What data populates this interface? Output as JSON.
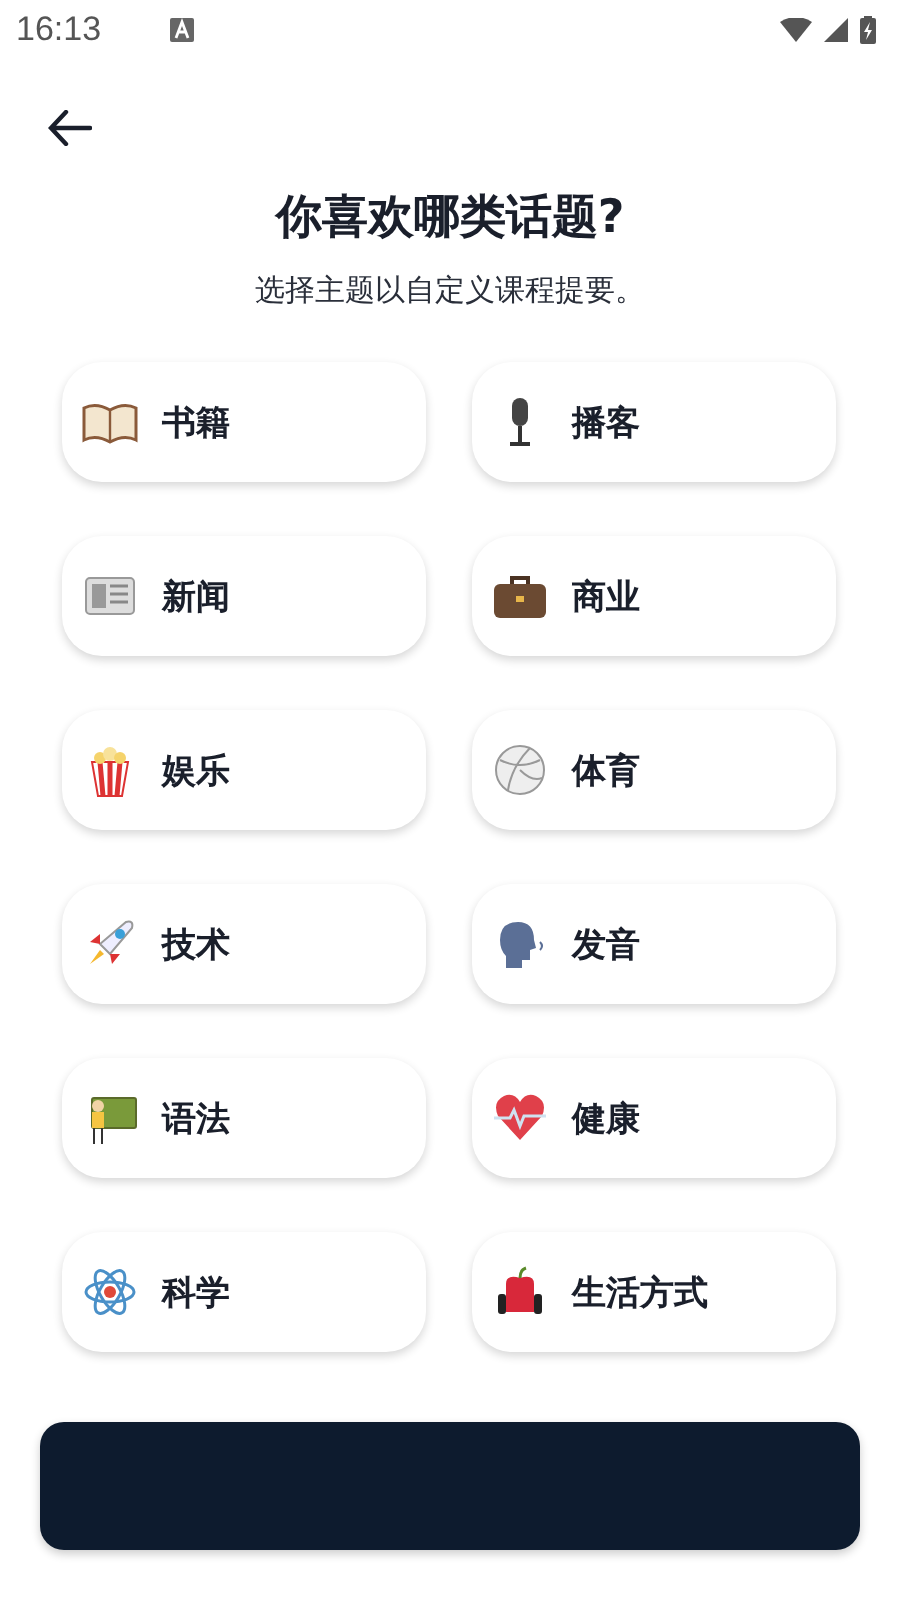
{
  "status_bar": {
    "time": "16:13"
  },
  "title": "你喜欢哪类话题?",
  "subtitle": "选择主题以自定义课程提要。",
  "topics": [
    {
      "label": "书籍"
    },
    {
      "label": "播客"
    },
    {
      "label": "新闻"
    },
    {
      "label": "商业"
    },
    {
      "label": "娱乐"
    },
    {
      "label": "体育"
    },
    {
      "label": "技术"
    },
    {
      "label": "发音"
    },
    {
      "label": "语法"
    },
    {
      "label": "健康"
    },
    {
      "label": "科学"
    },
    {
      "label": "生活方式"
    }
  ]
}
